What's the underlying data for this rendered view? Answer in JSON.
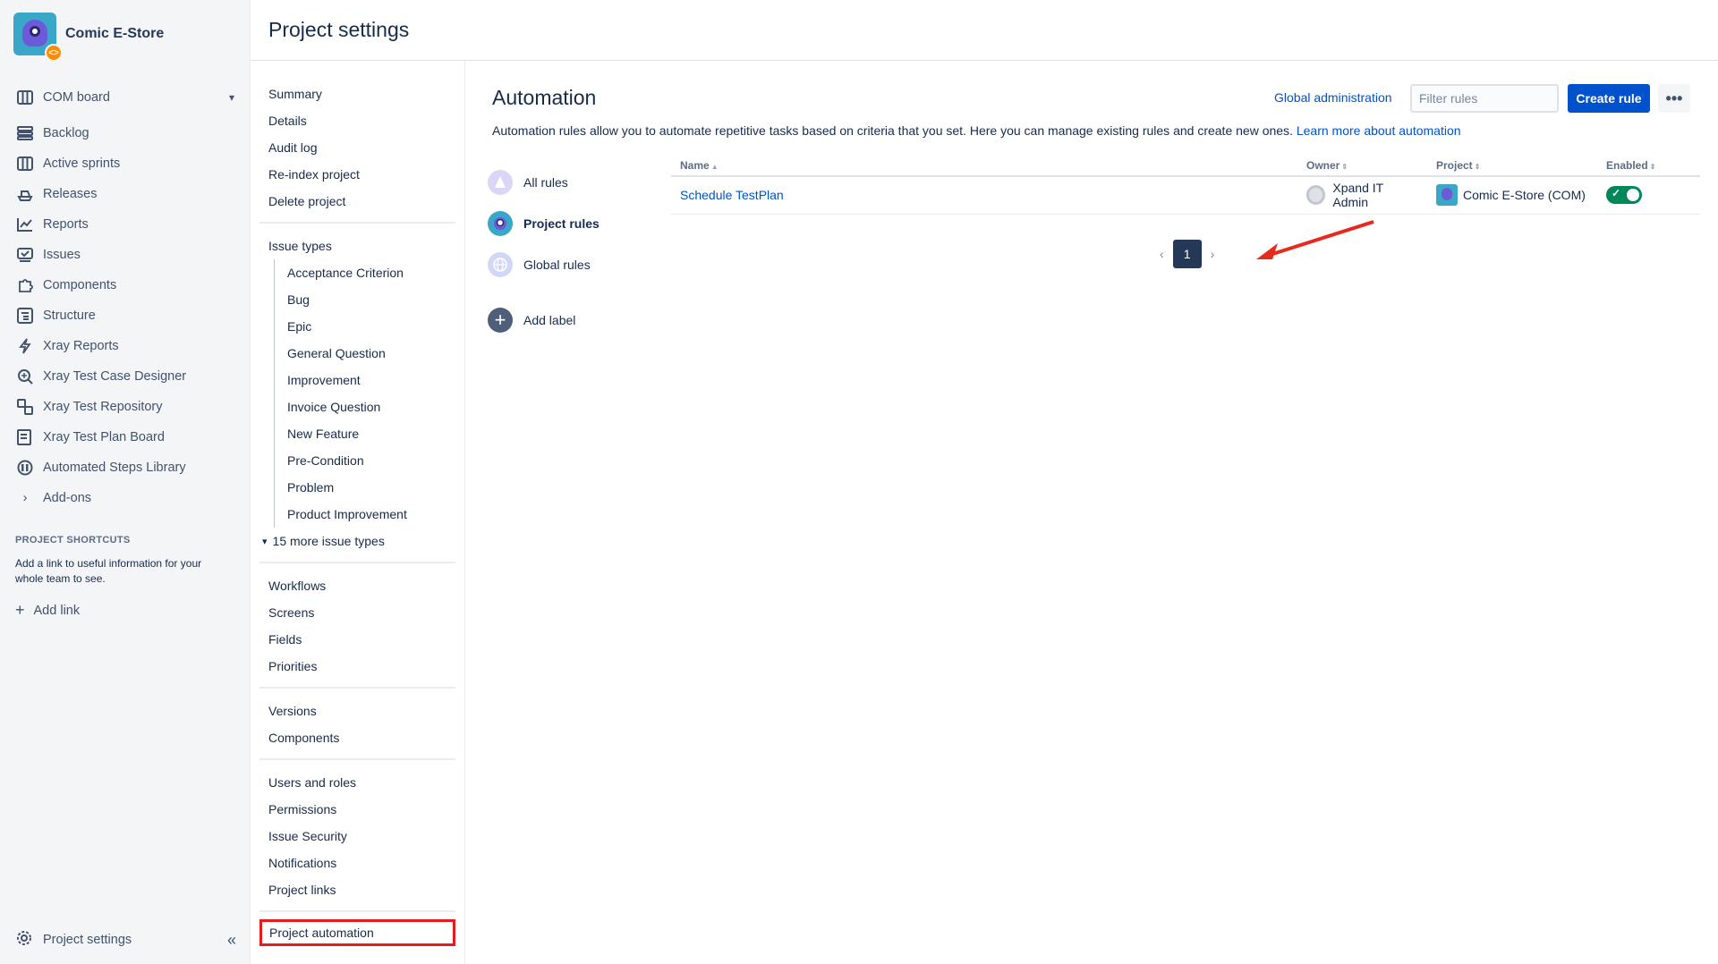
{
  "sidebar": {
    "project_name": "Comic E-Store",
    "board_label": "COM board",
    "items": [
      {
        "label": "Backlog",
        "icon": "backlog-icon"
      },
      {
        "label": "Active sprints",
        "icon": "board-icon"
      },
      {
        "label": "Releases",
        "icon": "ship-icon"
      },
      {
        "label": "Reports",
        "icon": "chart-icon"
      },
      {
        "label": "Issues",
        "icon": "issues-icon"
      },
      {
        "label": "Components",
        "icon": "puzzle-icon"
      },
      {
        "label": "Structure",
        "icon": "structure-icon"
      },
      {
        "label": "Xray Reports",
        "icon": "bolt-icon"
      },
      {
        "label": "Xray Test Case Designer",
        "icon": "designer-icon"
      },
      {
        "label": "Xray Test Repository",
        "icon": "repository-icon"
      },
      {
        "label": "Xray Test Plan Board",
        "icon": "plan-board-icon"
      },
      {
        "label": "Automated Steps Library",
        "icon": "library-icon"
      },
      {
        "label": "Add-ons",
        "icon": "chevron-right-icon"
      }
    ],
    "shortcuts_title": "PROJECT SHORTCUTS",
    "shortcuts_desc": "Add a link to useful information for your whole team to see.",
    "add_link": "Add link",
    "bottom_label": "Project settings"
  },
  "header": {
    "title": "Project settings"
  },
  "settings_nav": {
    "group1": [
      "Summary",
      "Details",
      "Audit log",
      "Re-index project",
      "Delete project"
    ],
    "issue_types_label": "Issue types",
    "issue_types": [
      "Acceptance Criterion",
      "Bug",
      "Epic",
      "General Question",
      "Improvement",
      "Invoice Question",
      "New Feature",
      "Pre-Condition",
      "Problem",
      "Product Improvement"
    ],
    "more_issue_types": "15 more issue types",
    "group3": [
      "Workflows",
      "Screens",
      "Fields",
      "Priorities"
    ],
    "group4": [
      "Versions",
      "Components"
    ],
    "group5": [
      "Users and roles",
      "Permissions",
      "Issue Security",
      "Notifications",
      "Project links"
    ],
    "active": "Project automation"
  },
  "main": {
    "title": "Automation",
    "global_admin": "Global administration",
    "filter_placeholder": "Filter rules",
    "create_rule": "Create rule",
    "more": "•••",
    "description": "Automation rules allow you to automate repetitive tasks based on criteria that you set. Here you can manage existing rules and create new ones.",
    "learn_more": "Learn more about automation",
    "categories": [
      "All rules",
      "Project rules",
      "Global rules"
    ],
    "add_label": "Add label",
    "table": {
      "headers": {
        "name": "Name",
        "owner": "Owner",
        "project": "Project",
        "enabled": "Enabled"
      },
      "rows": [
        {
          "name": "Schedule TestPlan",
          "owner": "Xpand IT Admin",
          "project": "Comic E-Store (COM)",
          "enabled": true
        }
      ]
    },
    "pagination": {
      "current": "1"
    }
  },
  "colors": {
    "accent": "#0052cc",
    "toggle_on": "#00875a",
    "highlight": "#e31d1d",
    "annotation_arrow": "#e52b1f"
  }
}
